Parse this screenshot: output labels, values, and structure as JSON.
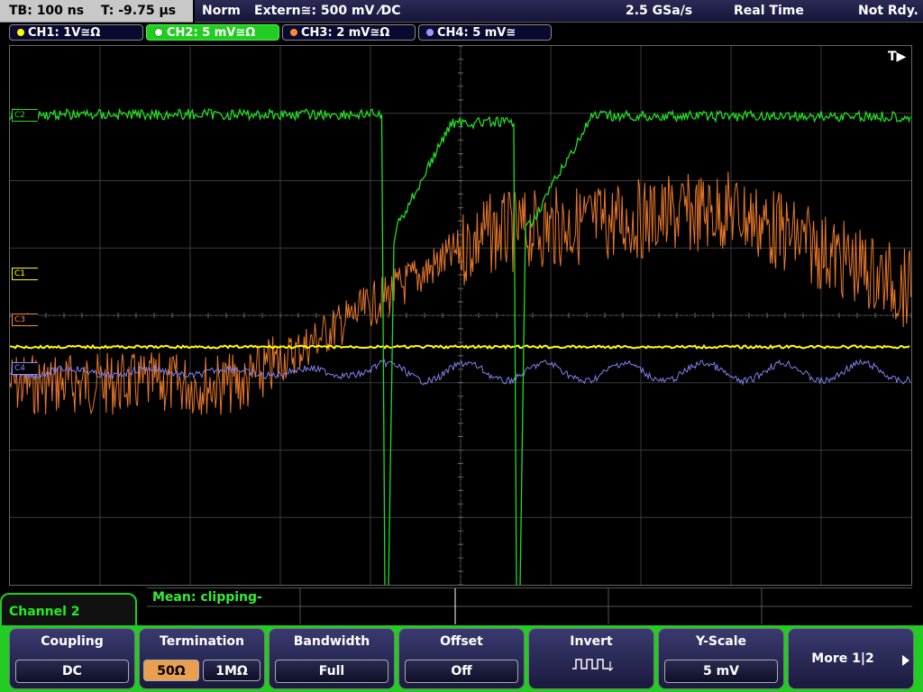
{
  "timebase": {
    "tb": "TB: 100 ns",
    "trigger_time": "T: -9.75 µs"
  },
  "status": {
    "mode": "Norm",
    "trigger": "Extern≅: 500 mV ⁄DC",
    "rate": "2.5 GSa/s",
    "acq": "Real Time",
    "state": "Not Rdy."
  },
  "channels": [
    {
      "label": "CH1: 1V≅Ω",
      "color": "#ffff00"
    },
    {
      "label": "CH2: 5 mV≅Ω",
      "color": "#22dd22"
    },
    {
      "label": "CH3: 2 mV≅Ω",
      "color": "#ff8833"
    },
    {
      "label": "CH4: 5 mV≅",
      "color": "#8888ff"
    }
  ],
  "grid": {
    "trigger_marker": "T▶",
    "ch1_marker": "C1",
    "ch3_marker": "C3",
    "ch4_marker": "C4",
    "ch2_marker": "C2"
  },
  "measurement": {
    "text": "Mean: clipping-"
  },
  "menu": {
    "title": "Channel 2",
    "coupling": {
      "title": "Coupling",
      "value": "DC"
    },
    "termination": {
      "title": "Termination",
      "opt1": "50Ω",
      "opt2": "1MΩ"
    },
    "bandwidth": {
      "title": "Bandwidth",
      "value": "Full"
    },
    "offset": {
      "title": "Offset",
      "value": "Off"
    },
    "invert": {
      "title": "Invert"
    },
    "yscale": {
      "title": "Y-Scale",
      "value": "5 mV"
    },
    "more": {
      "label": "More 1|2"
    }
  }
}
